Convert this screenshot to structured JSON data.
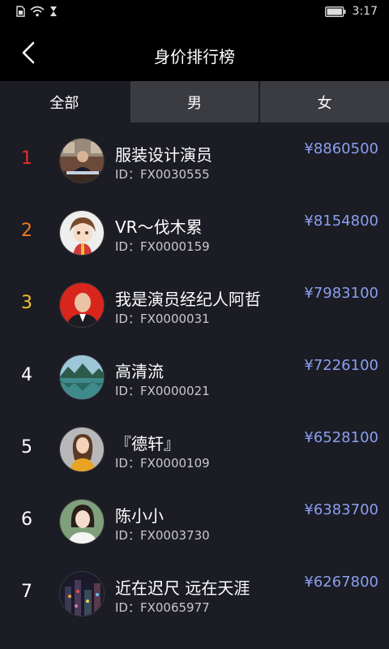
{
  "status_bar": {
    "time": "3:17",
    "icons": [
      "sim-card-icon",
      "wifi-icon",
      "hourglass-icon",
      "battery-icon"
    ]
  },
  "header": {
    "title": "身价排行榜",
    "back_icon": "chevron-left-icon"
  },
  "tabs": [
    {
      "label": "全部",
      "active": true
    },
    {
      "label": "男",
      "active": false
    },
    {
      "label": "女",
      "active": false
    }
  ],
  "colors": {
    "rank1": "#e0302b",
    "rank2": "#f07d1e",
    "rank3": "#f2c12a",
    "rank_default": "#ffffff",
    "price": "#8a9fef",
    "background": "#1b1c24"
  },
  "ranking": [
    {
      "rank": "1",
      "name": "服装设计演员",
      "id": "ID：FX0030555",
      "price": "¥8860500",
      "avatar": "man-in-office-avatar"
    },
    {
      "rank": "2",
      "name": "VR～伐木累",
      "id": "ID：FX0000159",
      "price": "¥8154800",
      "avatar": "cartoon-boy-avatar"
    },
    {
      "rank": "3",
      "name": "我是演员经纪人阿哲",
      "id": "ID：FX0000031",
      "price": "¥7983100",
      "avatar": "man-red-background-avatar"
    },
    {
      "rank": "4",
      "name": "高清流",
      "id": "ID：FX0000021",
      "price": "¥7226100",
      "avatar": "lake-landscape-avatar"
    },
    {
      "rank": "5",
      "name": "『德轩』",
      "id": "ID：FX0000109",
      "price": "¥6528100",
      "avatar": "woman-yellow-top-avatar"
    },
    {
      "rank": "6",
      "name": "陈小小",
      "id": "ID：FX0003730",
      "price": "¥6383700",
      "avatar": "girl-portrait-avatar"
    },
    {
      "rank": "7",
      "name": "近在迟尺  远在天涯",
      "id": "ID：FX0065977",
      "price": "¥6267800",
      "avatar": "city-night-avatar"
    }
  ]
}
